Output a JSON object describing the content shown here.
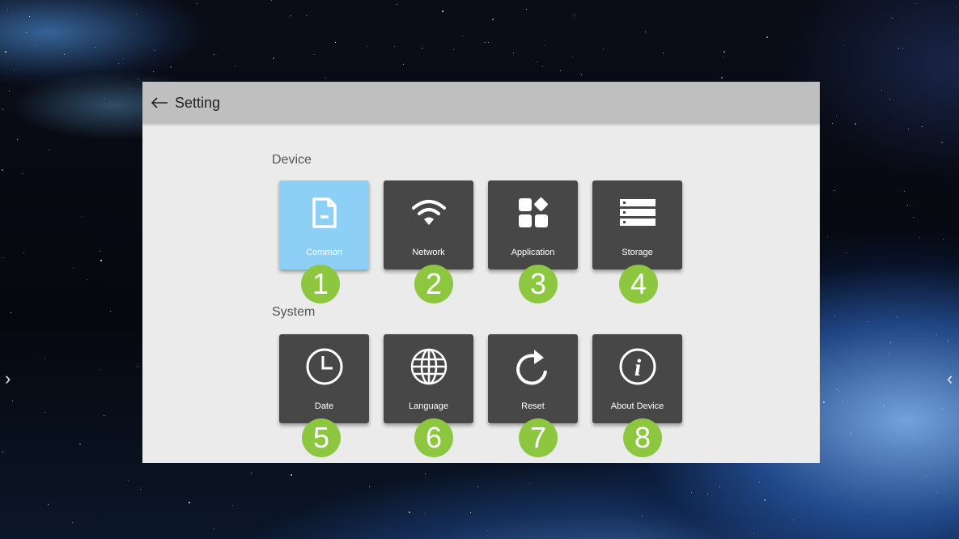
{
  "header": {
    "title": "Setting"
  },
  "sections": {
    "device": {
      "label": "Device",
      "tiles": [
        {
          "label": "Common",
          "icon": "document-icon",
          "badge": "1"
        },
        {
          "label": "Network",
          "icon": "wifi-icon",
          "badge": "2"
        },
        {
          "label": "Application",
          "icon": "apps-grid-icon",
          "badge": "3"
        },
        {
          "label": "Storage",
          "icon": "storage-icon",
          "badge": "4"
        }
      ]
    },
    "system": {
      "label": "System",
      "tiles": [
        {
          "label": "Date",
          "icon": "clock-icon",
          "badge": "5"
        },
        {
          "label": "Language",
          "icon": "globe-icon",
          "badge": "6"
        },
        {
          "label": "Reset",
          "icon": "reset-icon",
          "badge": "7"
        },
        {
          "label": "About Device",
          "icon": "info-icon",
          "badge": "8"
        }
      ]
    }
  },
  "colors": {
    "active_tile": "#8dcff5",
    "tile": "#474747",
    "badge": "#8dc63f",
    "panel": "#ebebeb",
    "titlebar": "#bfbfbf"
  }
}
